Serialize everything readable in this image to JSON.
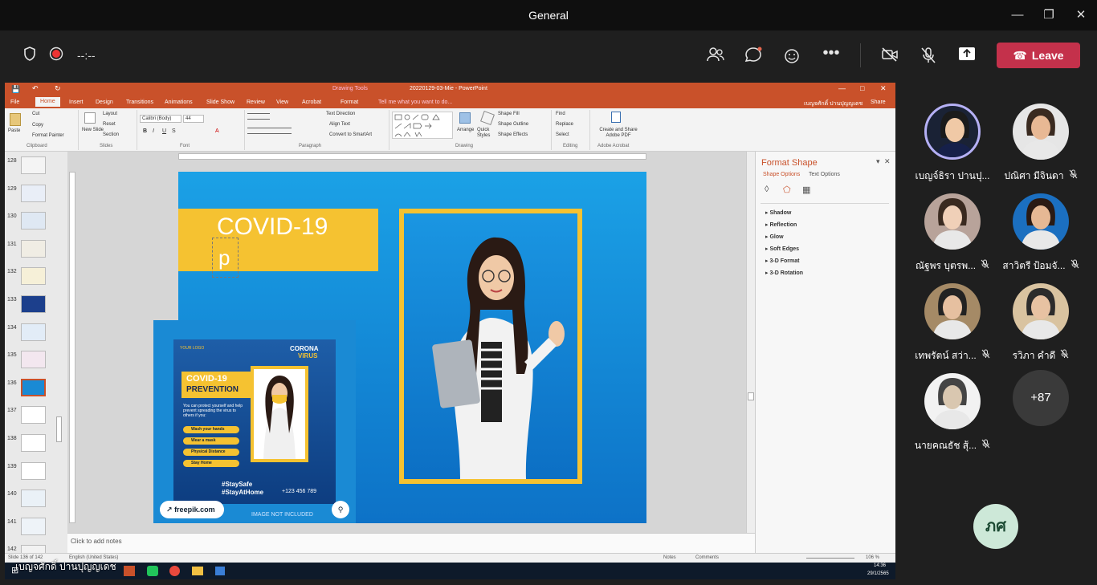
{
  "window": {
    "title": "General"
  },
  "meeting": {
    "timer": "--:--",
    "leave_label": "Leave",
    "controls": [
      "people-icon",
      "chat-icon",
      "reaction-icon",
      "more-icon",
      "camera-off-icon",
      "mic-off-icon",
      "share-screen-icon"
    ]
  },
  "ppt": {
    "file_title": "20220129-03-Mie - PowerPoint",
    "context_tab": "Drawing Tools",
    "tabs": [
      "File",
      "Home",
      "Insert",
      "Design",
      "Transitions",
      "Animations",
      "Slide Show",
      "Review",
      "View",
      "Acrobat",
      "Format"
    ],
    "tell_me": "Tell me what you want to do...",
    "user_name": "เบญจศักดิ์ ปานปุญญเดช",
    "share_label": "Share",
    "ribbon": {
      "paste": "Paste",
      "cut": "Cut",
      "copy": "Copy",
      "format_painter": "Format Painter",
      "clipboard": "Clipboard",
      "new_slide": "New Slide",
      "layout": "Layout",
      "reset": "Reset",
      "section": "Section",
      "slides": "Slides",
      "font_name": "Calibri (Body)",
      "font_size": "44",
      "font": "Font",
      "text_direction": "Text Direction",
      "align_text": "Align Text",
      "convert_smartart": "Convert to SmartArt",
      "paragraph": "Paragraph",
      "arrange": "Arrange",
      "quick_styles": "Quick Styles",
      "shape_fill": "Shape Fill",
      "shape_outline": "Shape Outline",
      "shape_effects": "Shape Effects",
      "drawing": "Drawing",
      "find": "Find",
      "replace": "Replace",
      "select": "Select",
      "editing": "Editing",
      "create_share_pdf": "Create and Share Adobe PDF",
      "adobe_acrobat": "Adobe Acrobat"
    },
    "slide_numbers": [
      "128",
      "129",
      "130",
      "131",
      "132",
      "133",
      "134",
      "135",
      "136",
      "137",
      "138",
      "139",
      "140",
      "141",
      "142"
    ],
    "active_slide": "136",
    "slide": {
      "heading": "COVID-19",
      "typing": "p",
      "poster": {
        "logo": "YOUR LOGO",
        "corona": "CORONA",
        "virus": "VIRUS",
        "title1": "COVID-19",
        "title2": "PREVENTION",
        "body": "You can protect yourself and help prevent spreading the virus to others if you:",
        "items": [
          "Wash your hands",
          "Wear a mask",
          "Physical Distance",
          "Stay Home"
        ],
        "hashtag1": "#StaySafe",
        "hashtag2": "#StayAtHome",
        "phone": "+123 456 789",
        "freepik": "freepik.com",
        "not_included": "IMAGE NOT INCLUDED"
      }
    },
    "format_pane": {
      "title": "Format Shape",
      "tab1": "Shape Options",
      "tab2": "Text Options",
      "sections": [
        "Shadow",
        "Reflection",
        "Glow",
        "Soft Edges",
        "3-D Format",
        "3-D Rotation"
      ]
    },
    "notes_placeholder": "Click to add notes",
    "status": {
      "slide_of": "Slide 136 of 142",
      "language": "English (United States)",
      "notes": "Notes",
      "comments": "Comments",
      "zoom": "106 %"
    },
    "taskbar": {
      "time": "14:36",
      "date": "29/1/2565"
    }
  },
  "presenter_caption": "เบญจศักดิ์ ปานปุญญเดช",
  "participants": [
    {
      "name": "เบญจ์ธิรา ปานปุ...",
      "muted": false,
      "speaking": true
    },
    {
      "name": "ปณิศา มีจินดา",
      "muted": true
    },
    {
      "name": "ณัฐพร บุตรพ...",
      "muted": true
    },
    {
      "name": "สาวิตรี ป้อมจั...",
      "muted": true
    },
    {
      "name": "เทพรัตน์ สว่า...",
      "muted": true
    },
    {
      "name": "รวิภา คำดี",
      "muted": true
    },
    {
      "name": "นายคณธัช สุ้...",
      "muted": true
    }
  ],
  "more_participants": "+87",
  "self_initials": "ภศ"
}
